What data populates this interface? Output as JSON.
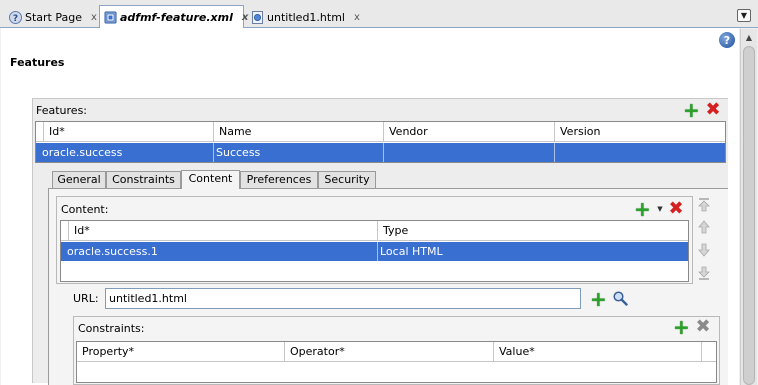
{
  "tabs": [
    {
      "label": "Start Page",
      "icon": "help-icon"
    },
    {
      "label": "adfmf-feature.xml",
      "icon": "xml-file-icon",
      "active": true
    },
    {
      "label": "untitled1.html",
      "icon": "html-file-icon"
    }
  ],
  "tab_close_glyph": "x",
  "page": {
    "title": "Features"
  },
  "features": {
    "label": "Features:",
    "columns": [
      "Id*",
      "Name",
      "Vendor",
      "Version"
    ],
    "rows": [
      {
        "id": "oracle.success",
        "name": "Success",
        "vendor": "",
        "version": "",
        "selected": true
      }
    ]
  },
  "detail_tabs": [
    "General",
    "Constraints",
    "Content",
    "Preferences",
    "Security"
  ],
  "detail_active_tab": "Content",
  "content": {
    "label": "Content:",
    "columns": [
      "Id*",
      "Type"
    ],
    "rows": [
      {
        "id": "oracle.success.1",
        "type": "Local HTML",
        "selected": true
      }
    ]
  },
  "url": {
    "label": "URL:",
    "value": "untitled1.html"
  },
  "constraints": {
    "label": "Constraints:",
    "columns": [
      "Property*",
      "Operator*",
      "Value*"
    ],
    "rows": []
  },
  "colors": {
    "selection": "#3a6fd2",
    "add": "#2aa22a",
    "delete": "#d42020",
    "disabled": "#8a8a8a",
    "active_tab_border": "#8fa5c5"
  }
}
